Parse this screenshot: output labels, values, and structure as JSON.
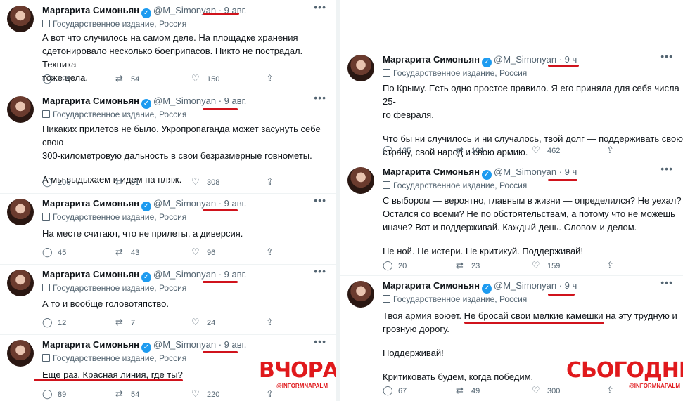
{
  "author": {
    "name": "Маргарита Симоньян",
    "handle": "@M_Simonyan",
    "dot": "·",
    "label": "Государственное издание, Россия",
    "verified_icon": "verified-badge-icon",
    "verified_color": "#1d9bf0"
  },
  "left": {
    "tweets": [
      {
        "time": "9 авг.",
        "paragraphs": [
          "А вот что случилось на самом деле. На площадке хранения",
          "сдетонировало несколько боеприпасов. Никто не пострадал. Техника",
          "тоже цела."
        ],
        "replies": "125",
        "retweets": "54",
        "likes": "150"
      },
      {
        "time": "9 авг.",
        "paragraphs": [
          "Никаких прилетов не было. Укропропаганда может засунуть себе свою",
          "300-километровую дальность в свои безразмерные говнометы.",
          "А мы выдыхаем и идем на пляж."
        ],
        "replies": "106",
        "retweets": "91",
        "likes": "308"
      },
      {
        "time": "9 авг.",
        "paragraphs": [
          "На месте считают, что не прилеты, а диверсия."
        ],
        "replies": "45",
        "retweets": "43",
        "likes": "96"
      },
      {
        "time": "9 авг.",
        "paragraphs": [
          "А то и вообще головотяпство."
        ],
        "replies": "12",
        "retweets": "7",
        "likes": "24"
      },
      {
        "time": "9 авг.",
        "paragraphs": [
          "Еще раз. Красная линия, где ты?"
        ],
        "replies": "89",
        "retweets": "54",
        "likes": "220"
      }
    ],
    "stamp": "ВЧОРА",
    "stamp_handle": "@INFORMNAPALM"
  },
  "right": {
    "tweets": [
      {
        "time": "9 ч",
        "paragraphs": [
          "По Крыму. Есть одно простое правило. Я его приняла для себя числа 25-",
          "го февраля.",
          "Что бы ни случилось и ни случалось, твой долг — поддерживать свою",
          "страну, свой народ и свою армию."
        ],
        "replies": "135",
        "retweets": "101",
        "likes": "462"
      },
      {
        "time": "9 ч",
        "paragraphs": [
          "С выбором — вероятно, главным в жизни — определился? Не уехал?",
          "Остался со всеми? Не по обстоятельствам, а потому что не можешь",
          "иначе? Вот и поддерживай. Каждый день. Словом и делом.",
          "Не ной. Не истери. Не критикуй. Поддерживай!"
        ],
        "replies": "20",
        "retweets": "23",
        "likes": "159"
      },
      {
        "time": "9 ч",
        "paragraphs": [
          "Твоя армия воюет. Не бросай свои мелкие камешки на эту трудную и",
          "грозную дорогу.",
          "Поддерживай!",
          "Критиковать будем, когда победим."
        ],
        "replies": "67",
        "retweets": "49",
        "likes": "300"
      }
    ],
    "stamp": "СЬОГОДНІ",
    "stamp_handle": "@INFORMNAPALM"
  },
  "icons": {
    "reply": "reply-icon",
    "retweet": "retweet-icon",
    "like": "heart-icon",
    "share": "share-icon",
    "more": "more-icon",
    "label": "government-flag-icon"
  },
  "colors": {
    "highlight": "#d0131c",
    "stamp": "#e0191c",
    "muted": "#536471",
    "verified": "#1d9bf0"
  }
}
